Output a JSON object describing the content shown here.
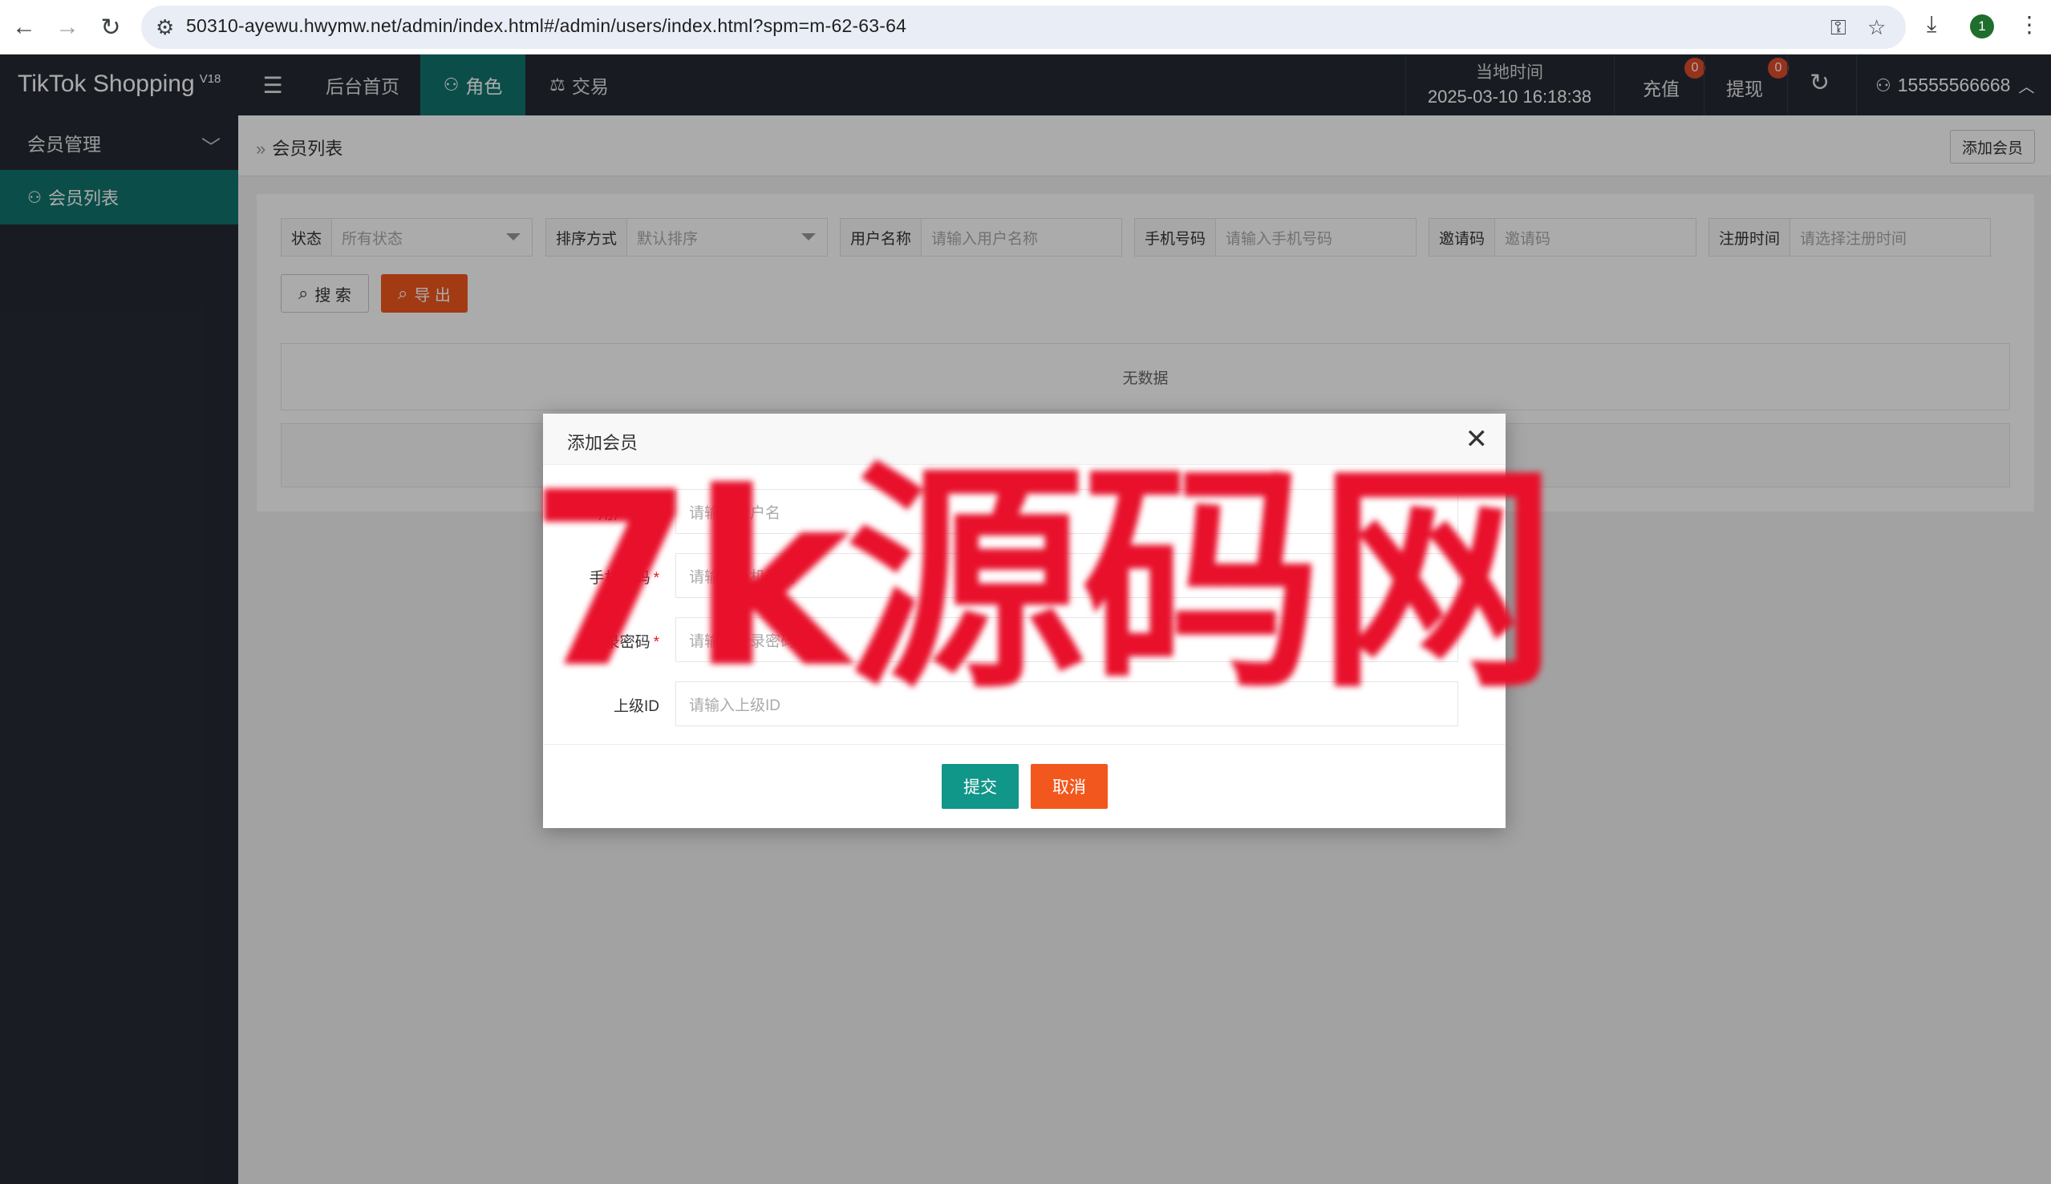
{
  "browser": {
    "url": "50310-ayewu.hwymw.net/admin/index.html#/admin/users/index.html?spm=m-62-63-64",
    "profile_initial": "1"
  },
  "header": {
    "brand": "TikTok Shopping",
    "brand_version": "V18",
    "tabs": [
      {
        "label": "后台首页",
        "icon": ""
      },
      {
        "label": "角色",
        "icon": "user-icon"
      },
      {
        "label": "交易",
        "icon": "scale-icon"
      }
    ],
    "local_time_label": "当地时间",
    "local_time_value": "2025-03-10 16:18:38",
    "recharge_label": "充值",
    "recharge_count": "0",
    "withdraw_label": "提现",
    "withdraw_count": "0",
    "user_phone": "15555566668"
  },
  "sidebar": {
    "group_label": "会员管理",
    "item_label": "会员列表"
  },
  "content": {
    "breadcrumb": "会员列表",
    "add_member_button": "添加会员",
    "filters": [
      {
        "label": "状态",
        "value": "所有状态"
      },
      {
        "label": "排序方式",
        "value": "默认排序"
      },
      {
        "label": "用户名称",
        "value": "请输入用户名称"
      },
      {
        "label": "手机号码",
        "value": "请输入手机号码"
      },
      {
        "label": "邀请码",
        "value": "邀请码"
      },
      {
        "label": "注册时间",
        "value": "请选择注册时间"
      }
    ],
    "search_button": "搜 索",
    "export_button": "导 出",
    "empty_text": "无数据"
  },
  "modal": {
    "title": "添加会员",
    "fields": [
      {
        "label": "用户名称",
        "placeholder": "请输入用户名",
        "required": false
      },
      {
        "label": "手机号码",
        "placeholder": "请输入手机号码",
        "required": true
      },
      {
        "label": "登录密码",
        "placeholder": "请输入登录密码",
        "required": true
      },
      {
        "label": "上级ID",
        "placeholder": "请输入上级ID",
        "required": false
      }
    ],
    "required_mark": "*",
    "submit_label": "提交",
    "cancel_label": "取消"
  },
  "watermark": "7k源码网",
  "colors": {
    "header_bg": "#252a34",
    "accent": "#11756d",
    "submit": "#11968a",
    "danger": "#f2581e",
    "badge": "#e14b2b",
    "watermark": "#e8102b"
  }
}
